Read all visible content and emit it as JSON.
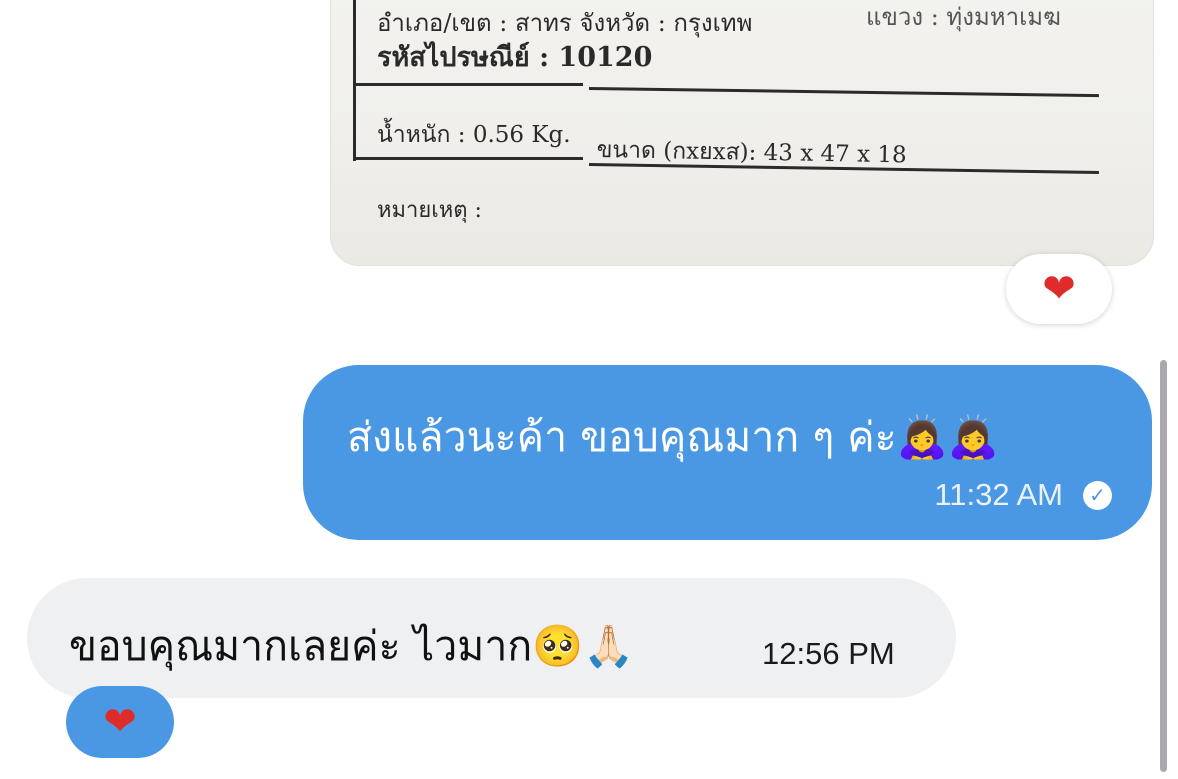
{
  "photo_message": {
    "label": {
      "district_line": "อำเภอ/เขต : สาทร  จังหวัด : กรุงเทพ",
      "top_right_fragment": "แขวง : ทุ่งมหาเมฆ",
      "postal_line": "รหัสไปรษณีย์ : 10120",
      "weight_line": "น้ำหนัก : 0.56 Kg.",
      "size_line": "ขนาด (กxยxส): 43 x 47 x 18",
      "note_line": "หมายเหตุ :"
    },
    "reaction": "❤"
  },
  "sent_message": {
    "text": "ส่งแล้วนะค้า ขอบคุณมาก ๆ ค่ะ🙇‍♀️🙇‍♀️",
    "time": "11:32 AM",
    "status_icon": "✓"
  },
  "received_message": {
    "text": "ขอบคุณมากเลยค่ะ ไวมาก🥺🙏🏻",
    "time": "12:56 PM",
    "reaction": "❤"
  },
  "colors": {
    "sent_bubble": "#4a97e4",
    "received_bubble": "#eef0f2",
    "heart": "#e02b2b"
  }
}
